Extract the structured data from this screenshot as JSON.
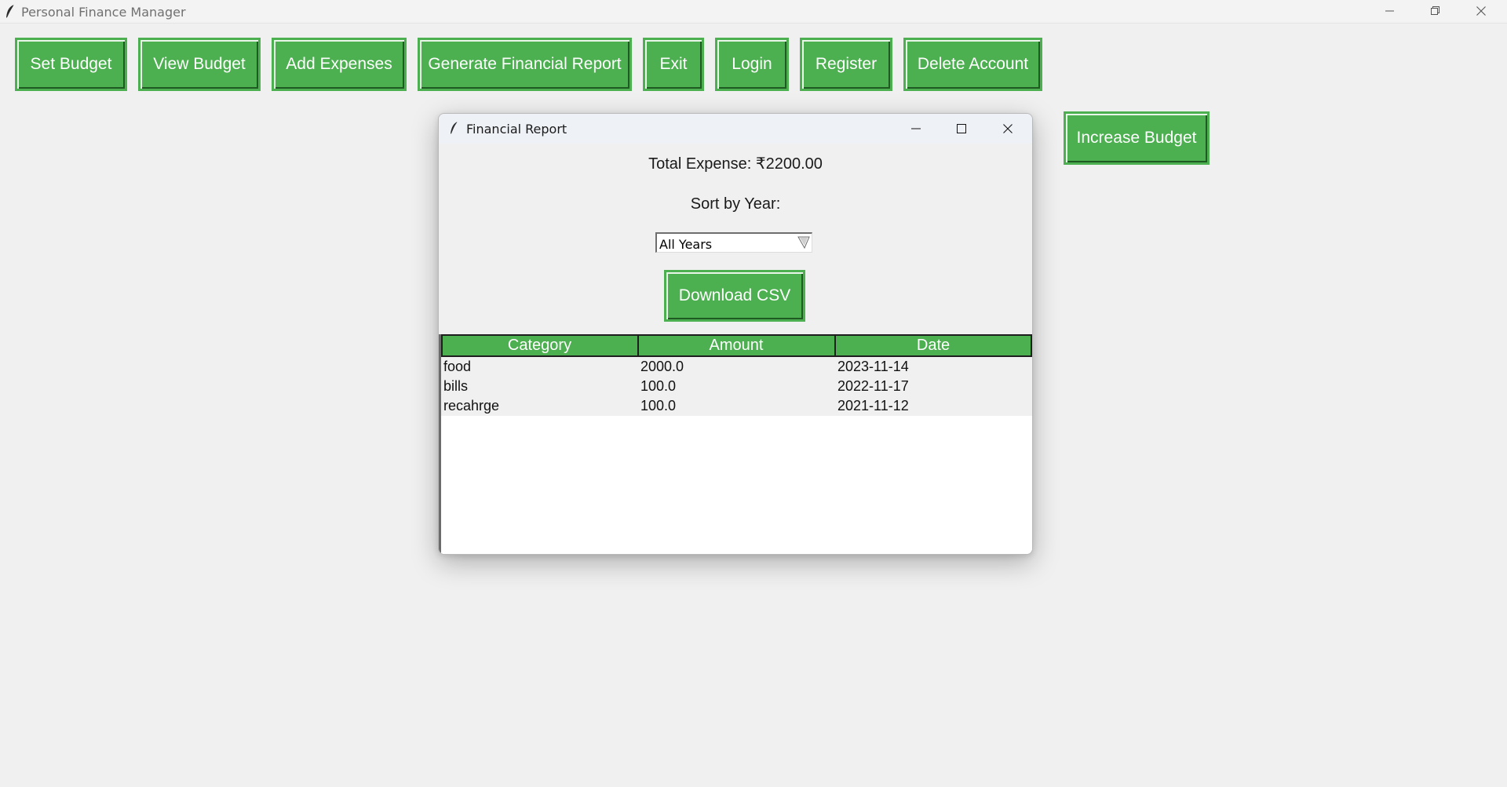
{
  "window": {
    "title": "Personal Finance Manager",
    "icon": "feather-icon"
  },
  "toolbar": {
    "buttons": [
      "Set Budget",
      "View Budget",
      "Add Expenses",
      "Generate Financial Report",
      "Exit",
      "Login",
      "Register",
      "Delete Account"
    ],
    "increase_budget": "Increase Budget"
  },
  "report": {
    "title": "Financial Report",
    "total_expense": "Total Expense: ₹2200.00",
    "sort_label": "Sort by Year:",
    "year_select": "All Years",
    "download_label": "Download CSV",
    "columns": [
      "Category",
      "Amount",
      "Date"
    ],
    "rows": [
      [
        "food",
        "2000.0",
        "2023-11-14"
      ],
      [
        "bills",
        "100.0",
        "2022-11-17"
      ],
      [
        "recahrge",
        "100.0",
        "2021-11-12"
      ]
    ]
  },
  "colors": {
    "button_green": "#4caf50",
    "background": "#f0f0f0"
  }
}
